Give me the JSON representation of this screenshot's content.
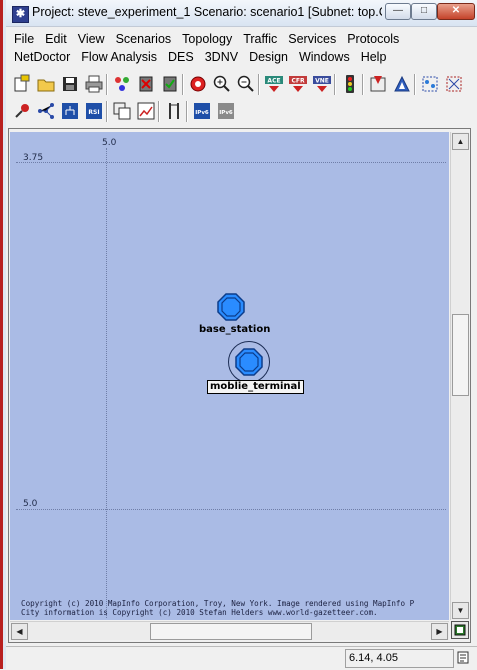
{
  "window": {
    "title": "Project: steve_experiment_1 Scenario: scenario1  [Subnet: top.Ca...",
    "minimize_glyph": "—",
    "maximize_glyph": "□",
    "close_glyph": "✕"
  },
  "menu": {
    "row1": [
      "File",
      "Edit",
      "View",
      "Scenarios",
      "Topology",
      "Traffic",
      "Services",
      "Protocols"
    ],
    "row2": [
      "NetDoctor",
      "Flow Analysis",
      "DES",
      "3DNV",
      "Design",
      "Windows",
      "Help"
    ]
  },
  "toolbar": {
    "ace_label": "ACE",
    "cfr_label": "CFR",
    "vne_label": "VNE",
    "rsi_label": "RSI",
    "ipv6_label": "IPv6",
    "ipv6b_label": "IPv6"
  },
  "canvas": {
    "background_color": "#aabbe5",
    "x_axis_label": "5.0",
    "y_axis_top_label": "3.75",
    "y_axis_bottom_label": "5.0",
    "nodes": [
      {
        "name": "base_station",
        "selected": false
      },
      {
        "name": "moblie_terminal",
        "selected": true
      }
    ],
    "copyright_line1": "Copyright (c) 2010 MapInfo Corporation, Troy, New York. Image rendered using MapInfo P",
    "copyright_line2": "City information is Copyright (c) 2010 Stefan Helders www.world-gazetteer.com."
  },
  "statusbar": {
    "coordinates": "6.14, 4.05"
  }
}
